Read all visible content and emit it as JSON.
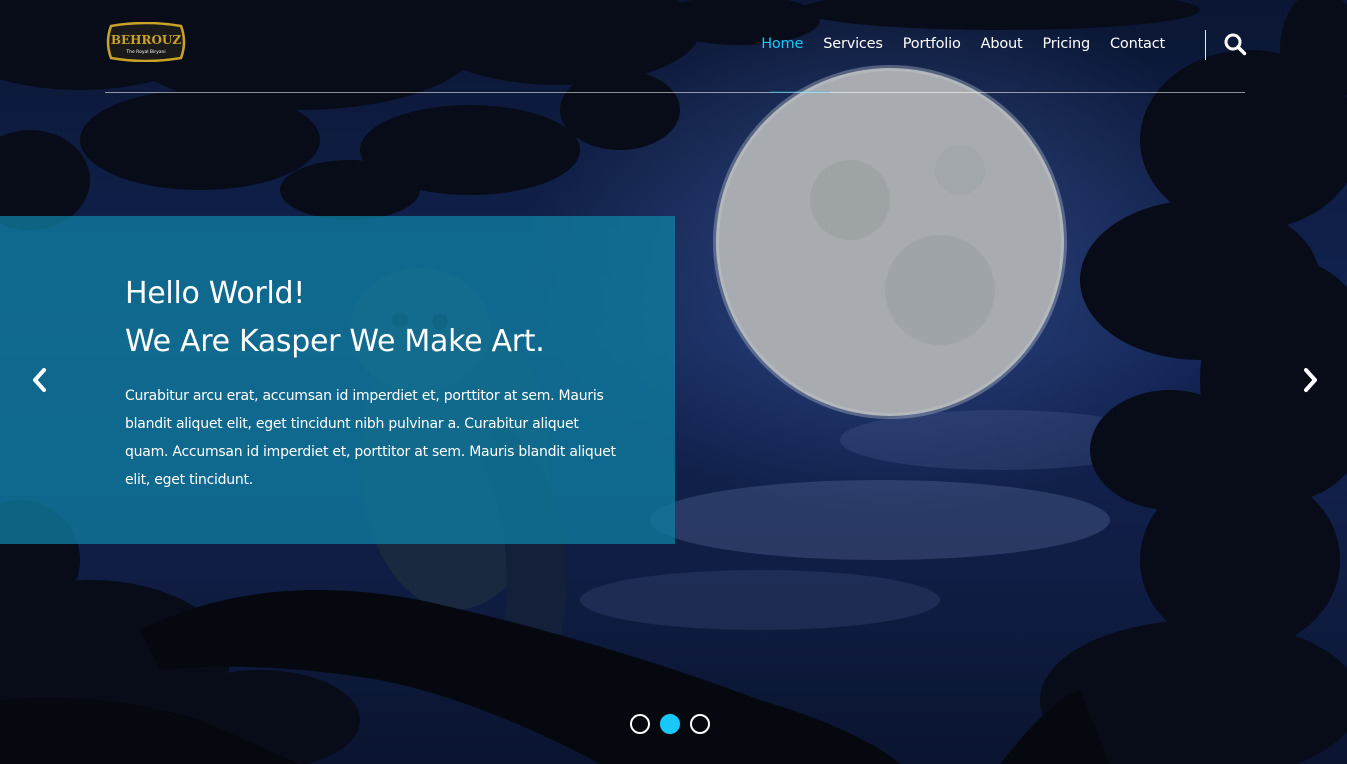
{
  "brand": {
    "logo_text": "BEHROUZ",
    "logo_tagline": "The Royal Biryani",
    "logo_colors": {
      "frame": "#c9a227",
      "fill": "#1a1a1a"
    }
  },
  "nav": {
    "items": [
      {
        "label": "Home",
        "active": true
      },
      {
        "label": "Services",
        "active": false
      },
      {
        "label": "Portfolio",
        "active": false
      },
      {
        "label": "About",
        "active": false
      },
      {
        "label": "Pricing",
        "active": false
      },
      {
        "label": "Contact",
        "active": false
      }
    ],
    "search_icon": "search-icon"
  },
  "hero": {
    "title_line1": "Hello World!",
    "title_line2": "We Are Kasper We Make Art.",
    "text": "Curabitur arcu erat, accumsan id imperdiet et, porttitor at sem. Mauris blandit aliquet elit, eget tincidunt nibh pulvinar a. Curabitur aliquet quam. Accumsan id imperdiet et, porttitor at sem. Mauris blandit aliquet elit, eget tincidunt.",
    "prev_icon": "chevron-left-icon",
    "next_icon": "chevron-right-icon"
  },
  "slider": {
    "bullets": [
      {
        "active": false
      },
      {
        "active": true
      },
      {
        "active": false
      }
    ]
  },
  "colors": {
    "accent": "#19c8fa",
    "overlay_box": "#0f7ca0",
    "background": "#0a1430"
  }
}
